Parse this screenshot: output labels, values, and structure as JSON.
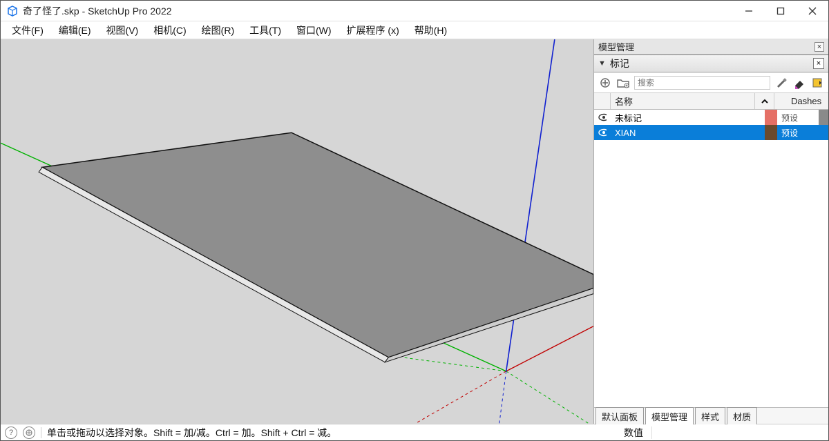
{
  "titlebar": {
    "title": "奇了怪了.skp - SketchUp Pro 2022"
  },
  "menubar": {
    "items": [
      "文件(F)",
      "编辑(E)",
      "视图(V)",
      "相机(C)",
      "绘图(R)",
      "工具(T)",
      "窗口(W)",
      "扩展程序 (x)",
      "帮助(H)"
    ]
  },
  "sidebar": {
    "outer_title": "模型管理",
    "panel": {
      "title": "标记",
      "search_placeholder": "搜索",
      "columns": {
        "name": "名称",
        "dashes": "Dashes"
      },
      "rows": [
        {
          "name": "未标记",
          "swatch": "#e57066",
          "dashes": "预设",
          "selected": false,
          "visible": true
        },
        {
          "name": "XIAN",
          "swatch": "#6a4a2e",
          "dashes": "预设",
          "selected": true,
          "visible": true
        }
      ]
    },
    "tabs": [
      "默认面板",
      "模型管理",
      "样式",
      "材质"
    ],
    "active_tab_index": 1
  },
  "statusbar": {
    "hint": "单击或拖动以选择对象。Shift = 加/减。Ctrl = 加。Shift + Ctrl = 减。",
    "value_label": "数值"
  }
}
